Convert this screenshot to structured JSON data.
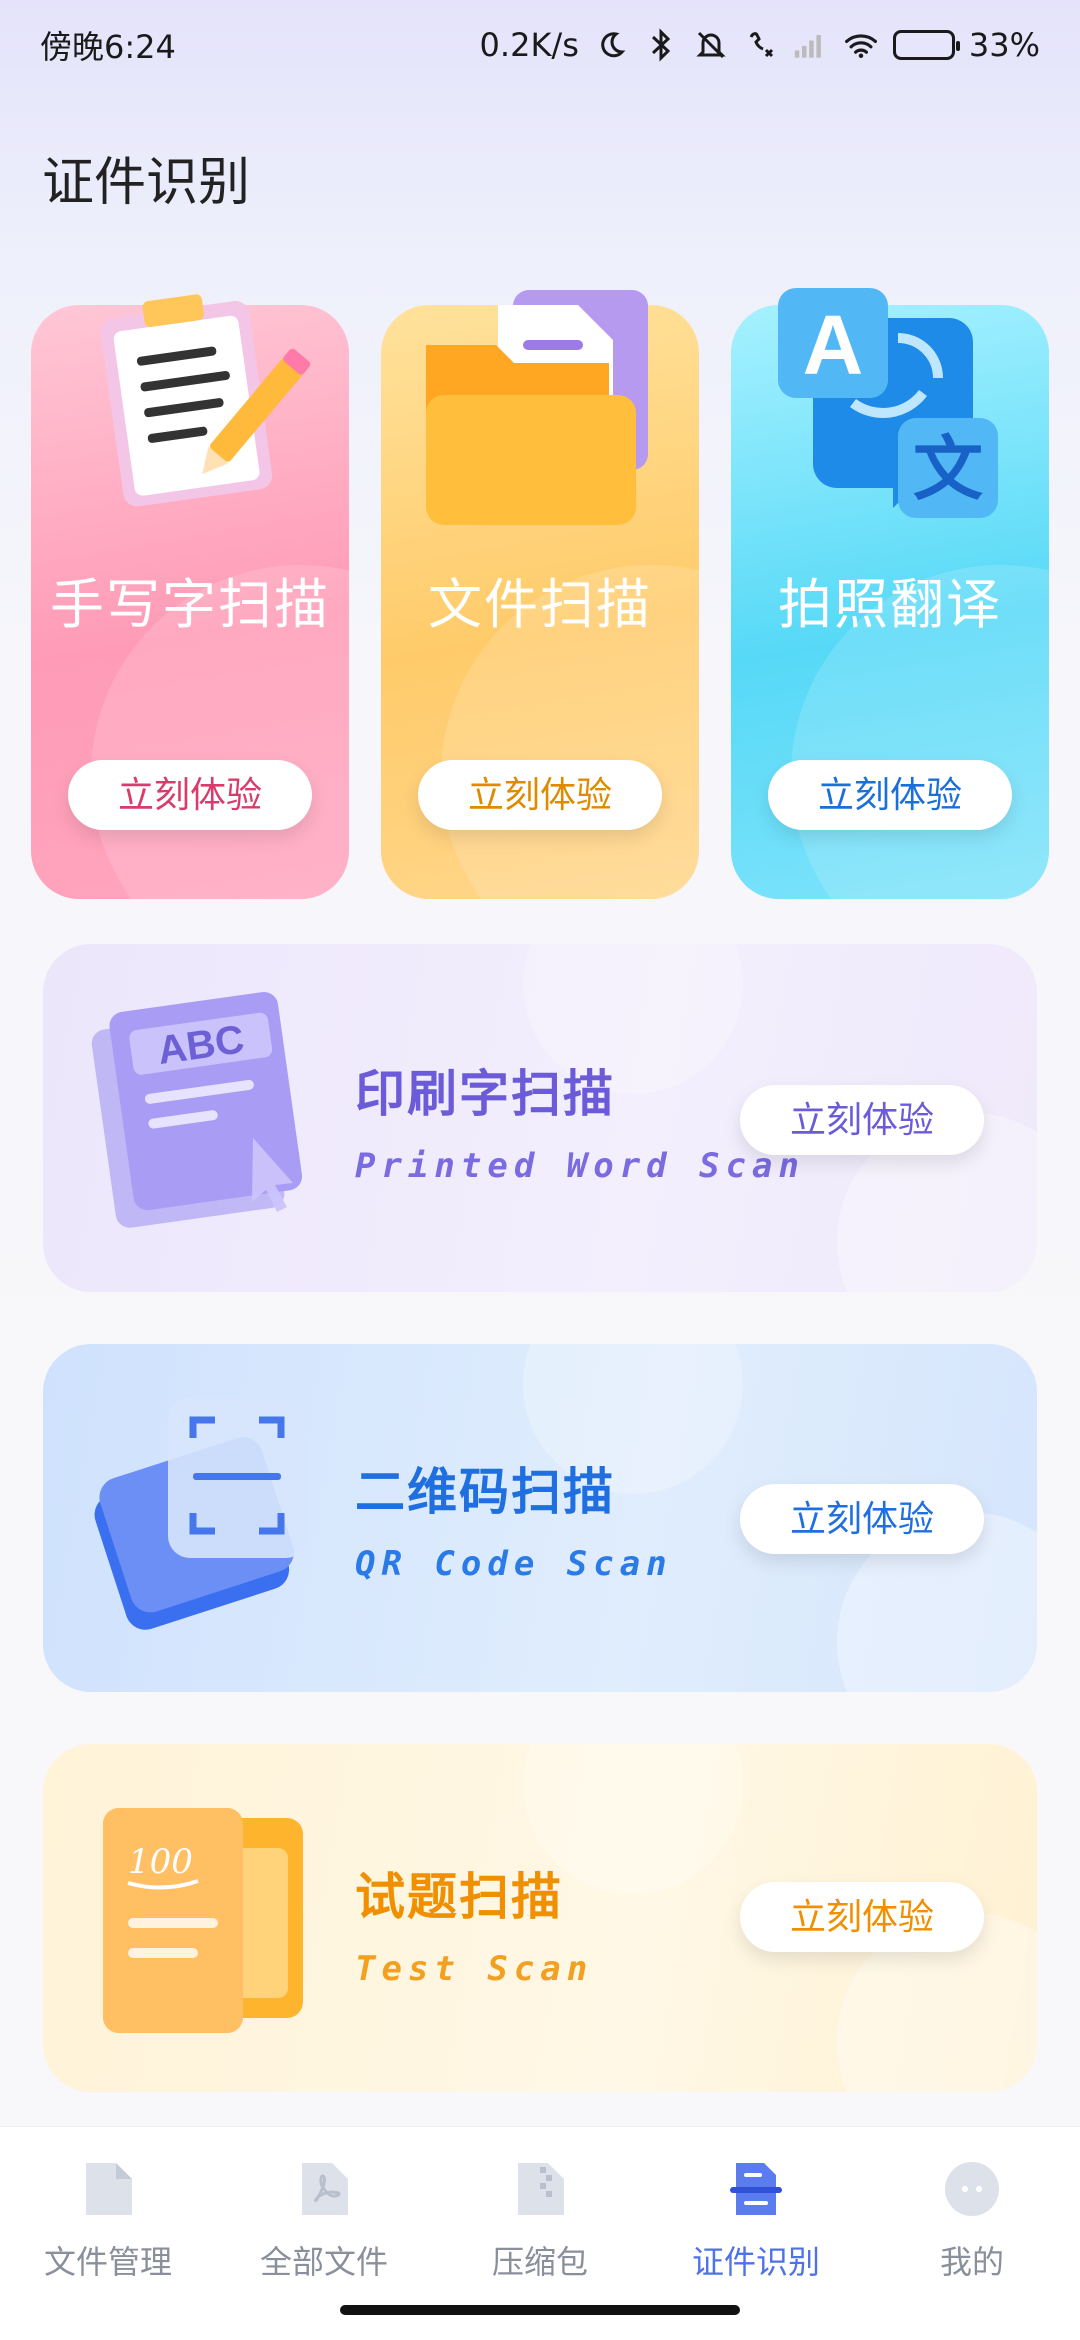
{
  "status_bar": {
    "time": "傍晚6:24",
    "network_speed": "0.2K/s",
    "battery": "33%",
    "battery_level": 0.33
  },
  "page": {
    "title": "证件识别"
  },
  "top_cards": [
    {
      "title": "手写字扫描",
      "button": "立刻体验",
      "icon": "clipboard-pencil-icon"
    },
    {
      "title": "文件扫描",
      "button": "立刻体验",
      "icon": "folder-document-icon"
    },
    {
      "title": "拍照翻译",
      "button": "立刻体验",
      "icon": "translate-icon"
    }
  ],
  "wide_cards": [
    {
      "title": "印刷字扫描",
      "subtitle": "Printed Word Scan",
      "button": "立刻体验",
      "icon": "printed-doc-icon"
    },
    {
      "title": "二维码扫描",
      "subtitle": "QR Code Scan",
      "button": "立刻体验",
      "icon": "qr-scan-icon"
    },
    {
      "title": "试题扫描",
      "subtitle": "Test Scan",
      "button": "立刻体验",
      "icon": "test-paper-icon"
    }
  ],
  "bottom_nav": [
    {
      "label": "文件管理",
      "icon": "file-icon",
      "active": false
    },
    {
      "label": "全部文件",
      "icon": "pdf-icon",
      "active": false
    },
    {
      "label": "压缩包",
      "icon": "zip-icon",
      "active": false
    },
    {
      "label": "证件识别",
      "icon": "scan-icon",
      "active": true
    },
    {
      "label": "我的",
      "icon": "profile-icon",
      "active": false
    }
  ],
  "colors": {
    "accent": "#4f72e6",
    "pink": "#ff9bb6",
    "orange": "#ffcb6a",
    "cyan": "#56d9f7"
  }
}
